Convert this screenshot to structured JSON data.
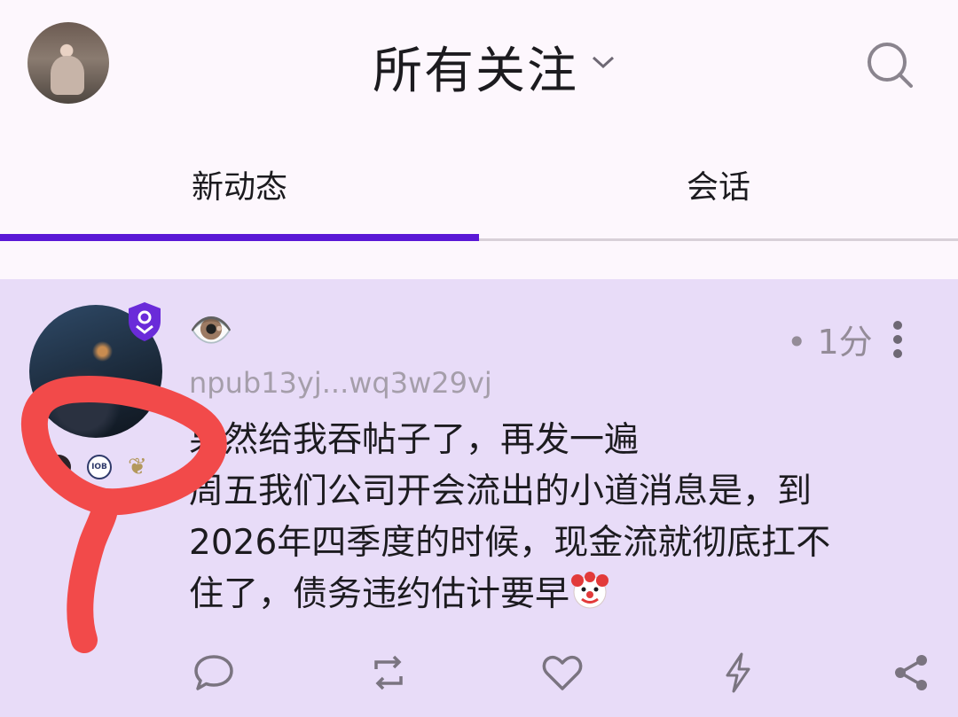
{
  "header": {
    "title": "所有关注",
    "icons": [
      "chevron-down-icon",
      "search-icon"
    ]
  },
  "tabs": [
    {
      "label": "新动态",
      "active": true
    },
    {
      "label": "会话",
      "active": false
    }
  ],
  "post": {
    "author_name": "👁️",
    "npub": "npub13yj...wq3w29vj",
    "time": "• 1分",
    "content_lines": [
      "果然给我吞帖子了，再发一遍",
      "周五我们公司开会流出的小道消息是，到",
      "2026年四季度的时候，现金流就彻底扛不",
      "住了，债务违约估计要早"
    ],
    "badge_text": "IOB",
    "actions": [
      "reply-icon",
      "repost-icon",
      "like-icon",
      "zap-icon",
      "share-icon"
    ]
  },
  "colors": {
    "accent": "#5a18d6",
    "post_background": "#e8dcf8",
    "annotation": "#f24a4a"
  }
}
